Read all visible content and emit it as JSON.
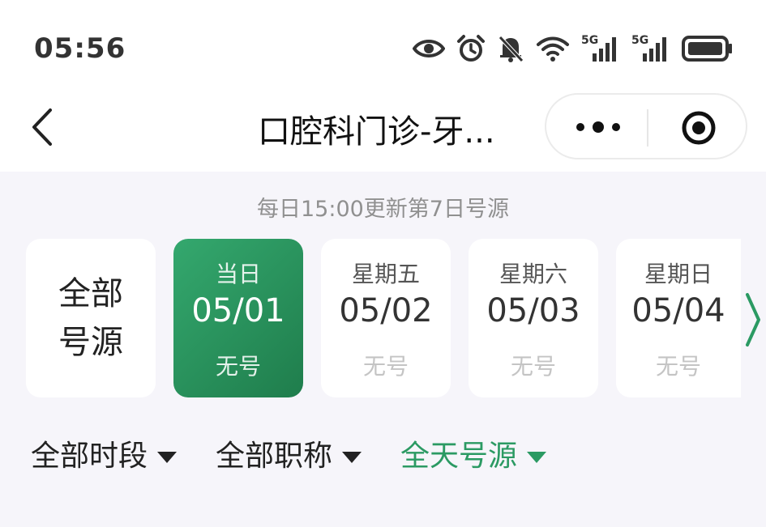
{
  "status_bar": {
    "time": "05:56",
    "icons": [
      "eye-icon",
      "alarm-icon",
      "bell-off-icon",
      "wifi-icon",
      "signal-5g-icon",
      "signal-5g-icon",
      "battery-icon"
    ],
    "net_label_1": "5G",
    "net_label_2": "5G"
  },
  "header": {
    "title": "口腔科门诊-牙...",
    "back_icon": "chevron-left-icon",
    "more_icon": "more-dots-icon",
    "close_icon": "target-close-icon"
  },
  "notice": "每日15:00更新第7日号源",
  "all_sources": {
    "line1": "全部",
    "line2": "号源"
  },
  "days": [
    {
      "weekday": "当日",
      "date": "05/01",
      "status": "无号",
      "selected": true
    },
    {
      "weekday": "星期五",
      "date": "05/02",
      "status": "无号",
      "selected": false
    },
    {
      "weekday": "星期六",
      "date": "05/03",
      "status": "无号",
      "selected": false
    },
    {
      "weekday": "星期日",
      "date": "05/04",
      "status": "无号",
      "selected": false
    }
  ],
  "filters": [
    {
      "label": "全部时段",
      "active": false
    },
    {
      "label": "全部职称",
      "active": false
    },
    {
      "label": "全天号源",
      "active": true
    }
  ],
  "colors": {
    "accent": "#2b9a63",
    "selected_card_start": "#34a86e",
    "selected_card_end": "#1f7d4c",
    "muted_text": "#c4c4c4"
  }
}
